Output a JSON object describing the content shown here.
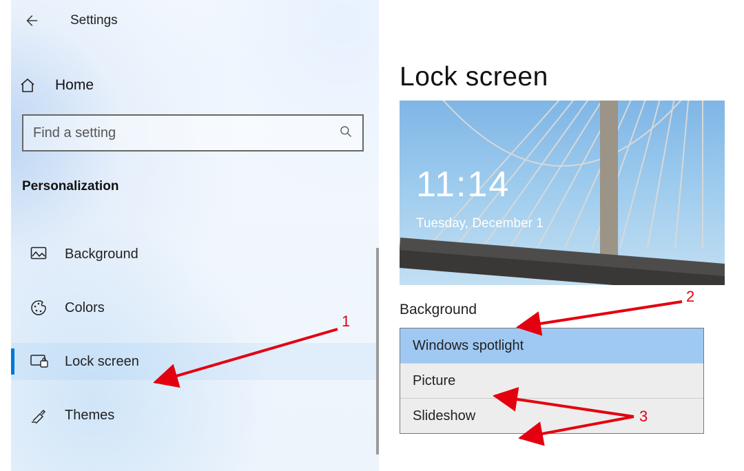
{
  "app": {
    "title": "Settings"
  },
  "nav": {
    "home": "Home",
    "search_placeholder": "Find a setting",
    "category": "Personalization",
    "items": [
      {
        "icon": "picture",
        "label": "Background"
      },
      {
        "icon": "palette",
        "label": "Colors"
      },
      {
        "icon": "lock-screen",
        "label": "Lock screen",
        "selected": true
      },
      {
        "icon": "themes",
        "label": "Themes"
      }
    ]
  },
  "page": {
    "title": "Lock screen",
    "preview": {
      "time": "11:14",
      "date": "Tuesday, December 1"
    },
    "background_section_label": "Background",
    "background_options": [
      {
        "label": "Windows spotlight",
        "selected": true
      },
      {
        "label": "Picture"
      },
      {
        "label": "Slideshow"
      }
    ]
  },
  "annotations": {
    "n1": "1",
    "n2": "2",
    "n3": "3"
  }
}
